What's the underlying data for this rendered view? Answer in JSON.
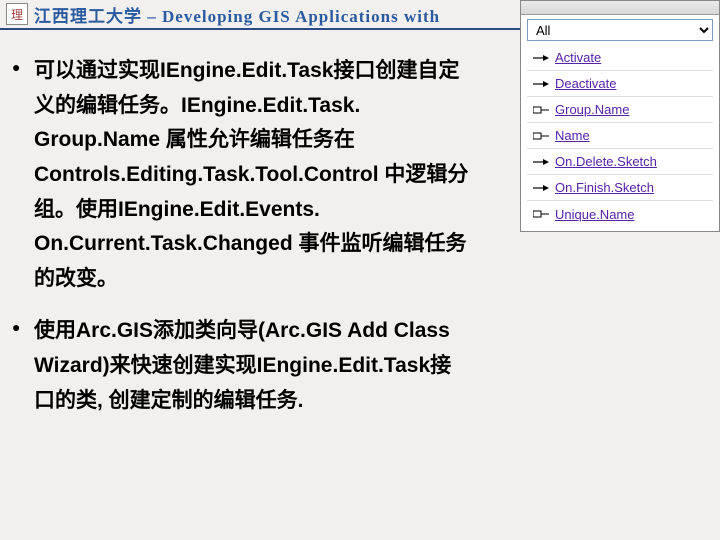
{
  "header": {
    "uni_text": "江西理工大学",
    "sep": " – ",
    "title_en": "Developing GIS Applications with"
  },
  "bullets": [
    "可以通过实现IEngine.Edit.Task接口创建自定义的编辑任务。IEngine.Edit.Task. Group.Name 属性允许编辑任务在Controls.Editing.Task.Tool.Control 中逻辑分组。使用IEngine.Edit.Events. On.Current.Task.Changed 事件监听编辑任务的改变。",
    "使用Arc.GIS添加类向导(Arc.GIS Add Class Wizard)来快速创建实现IEngine.Edit.Task接口的类, 创建定制的编辑任务."
  ],
  "panel": {
    "filter": "All",
    "members": [
      {
        "kind": "method",
        "name": "Activate"
      },
      {
        "kind": "method",
        "name": "Deactivate"
      },
      {
        "kind": "property",
        "name": "Group.Name"
      },
      {
        "kind": "property",
        "name": "Name"
      },
      {
        "kind": "method",
        "name": "On.Delete.Sketch"
      },
      {
        "kind": "method",
        "name": "On.Finish.Sketch"
      },
      {
        "kind": "property",
        "name": "Unique.Name"
      }
    ]
  }
}
